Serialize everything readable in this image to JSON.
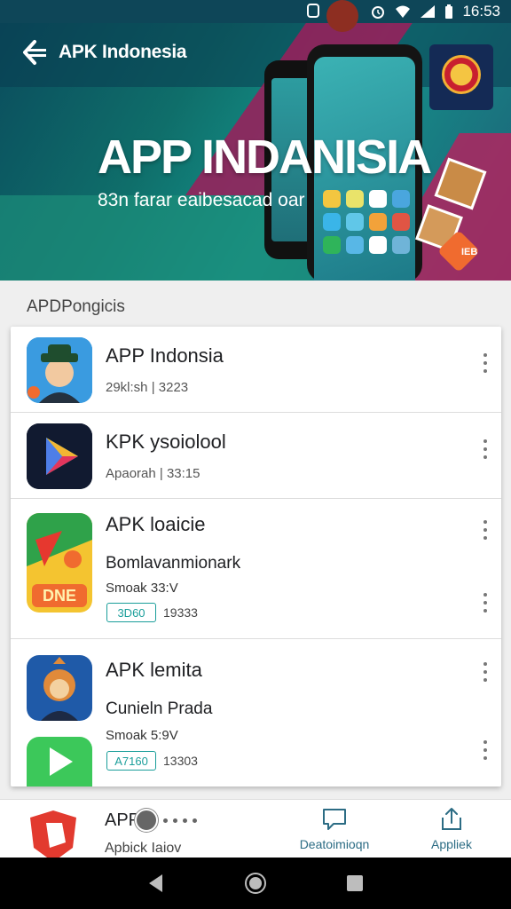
{
  "status_bar": {
    "time": "16:53"
  },
  "banner": {
    "brand_name": "APK Indonesia",
    "title": "APP INDANISIA",
    "subtitle": "83n farar eaibesacad oar",
    "side_badge": "IEB"
  },
  "section_title": "APDPongicis",
  "apps": [
    {
      "name": "APP Indonsia",
      "meta": "29kl:sh  |  3223",
      "icon": "detective-character-icon"
    },
    {
      "name": "KPK ysoiolool",
      "meta": "Apaorah  |  33:15",
      "icon": "play-store-icon"
    },
    {
      "name": "APK loaicie",
      "subtitle": "Bomlavanmionark",
      "detail": "Smoak 33:V",
      "tag": "3D60",
      "tag_num": "19333",
      "icon": "game-icon"
    },
    {
      "name": "APK lemita",
      "subtitle": "Cunieln Prada",
      "detail": "Smoak 5:9V",
      "tag": "A7160",
      "tag_num": "13303",
      "icon": "monkey-character-icon"
    }
  ],
  "bottom_bar": {
    "title": "APP",
    "subtitle": "Apbick Iaiov",
    "tabs": [
      {
        "label": "Deatoimioqn",
        "icon": "chat-icon"
      },
      {
        "label": "Appliek",
        "icon": "share-icon"
      }
    ]
  },
  "colors": {
    "accent": "#1a9e9a",
    "banner_dark": "#0e4658",
    "magenta": "#9d1d5a"
  }
}
